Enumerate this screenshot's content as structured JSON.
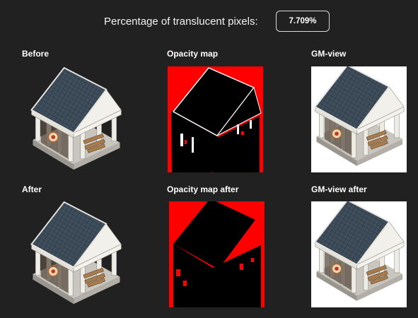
{
  "header": {
    "percentage_label": "Percentage of translucent pixels:",
    "percentage_value": "7.709%"
  },
  "panels": {
    "before": "Before",
    "opacity_map": "Opacity map",
    "gm_view": "GM-view",
    "after": "After",
    "opacity_map_after": "Opacity map after",
    "gm_view_after": "GM-view after"
  },
  "colors": {
    "background": "#212121",
    "opacity_red": "#ff0000",
    "opacity_black": "#000000",
    "roof": "#3b4a57"
  }
}
